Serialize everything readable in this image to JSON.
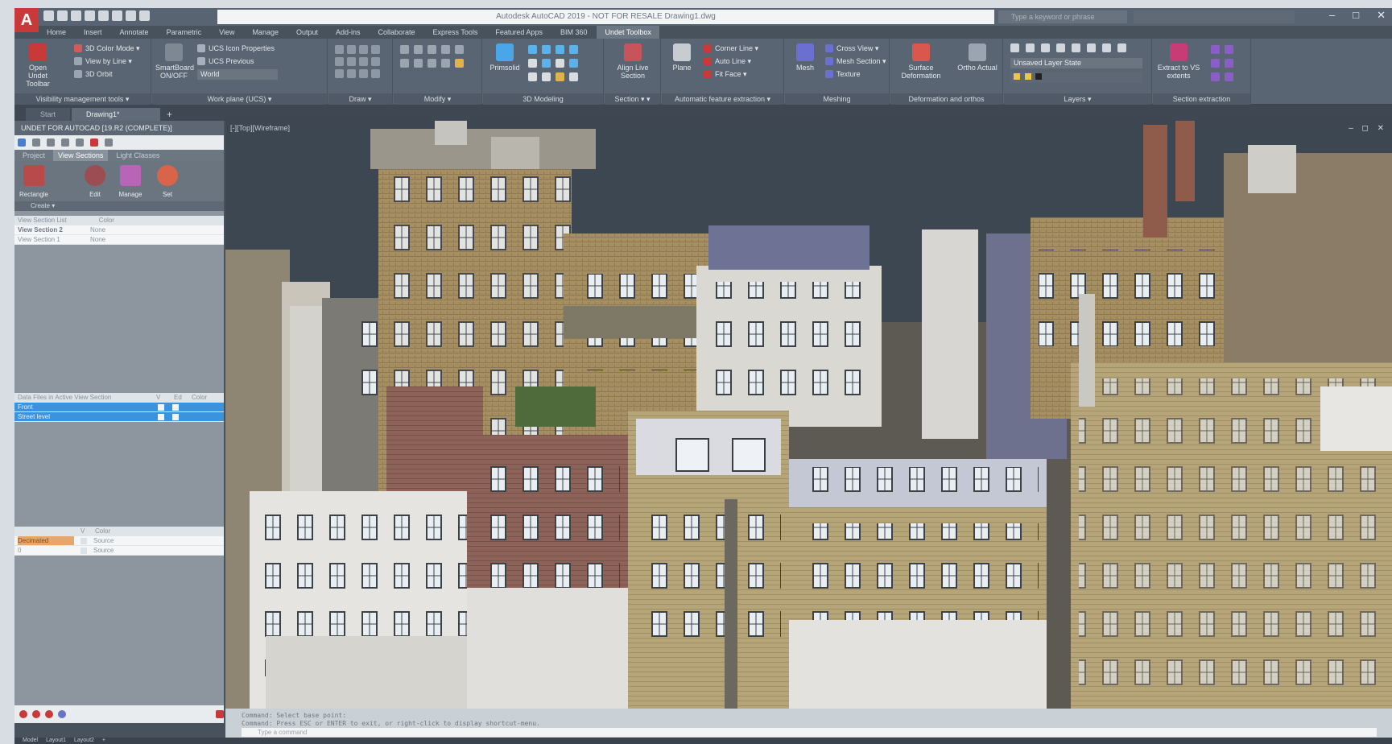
{
  "window": {
    "title": "Autodesk AutoCAD 2019 - NOT FOR RESALE   Drawing1.dwg",
    "logo": "A",
    "search_placeholder": "Type a keyword or phrase",
    "user": "",
    "controls": [
      "–",
      "□",
      "✕"
    ]
  },
  "ribbon_tabs": [
    "Home",
    "Insert",
    "Annotate",
    "Parametric",
    "View",
    "Manage",
    "Output",
    "Add-ins",
    "Collaborate",
    "Express Tools",
    "Featured Apps",
    "BIM 360",
    "Undet Toolbox"
  ],
  "ribbon_active_tab": 12,
  "ribbon": {
    "panels": [
      {
        "footer": "Visibility management tools ▾"
      },
      {
        "footer": "Work plane (UCS) ▾"
      },
      {
        "footer": "Draw ▾"
      },
      {
        "footer": "Modify ▾"
      },
      {
        "footer": "3D Modeling"
      },
      {
        "footer": "Section ▾  ▾"
      },
      {
        "footer": "Automatic feature extraction ▾"
      },
      {
        "footer": "Meshing"
      },
      {
        "footer": "Deformation and orthos"
      },
      {
        "footer": "Layers ▾"
      },
      {
        "footer": "Section extraction"
      }
    ],
    "open_undet_toolbar": "Open Undet Toolbar",
    "three_d_color_mode": "3D Color Mode ▾",
    "view_by_line": "View by Line ▾",
    "three_d_orbit": "3D Orbit",
    "smartboard": "SmartBoard ON/OFF",
    "ucs_icon_properties": "UCS Icon Properties",
    "ucs_previous": "UCS Previous",
    "world": "World",
    "primsolid": "Primsolid",
    "align_live_section": "Align Live Section",
    "plane": "Plane",
    "corner_line": "Corner Line ▾",
    "auto_line": "Auto Line ▾",
    "fit_face": "Fit Face ▾",
    "mesh": "Mesh",
    "cross_view": "Cross View ▾",
    "mesh_section": "Mesh Section ▾",
    "texture": "Texture",
    "surface_deformation": "Surface Deformation",
    "ortho_actual": "Ortho Actual",
    "unsaved_layer_state": "Unsaved Layer State",
    "extract_to_vs": "Extract to VS extents"
  },
  "file_tabs": [
    "Start",
    "Drawing1*"
  ],
  "file_tab_add": "+",
  "palette": {
    "title": "UNDET FOR AUTOCAD [19.R2 (COMPLETE)]",
    "tabs": [
      "Project",
      "View Sections",
      "Light Classes"
    ],
    "active_tab": 1,
    "tools": [
      "Rectangle",
      "Edit",
      "Manage",
      "Set"
    ],
    "tools_footer": "Create ▾",
    "view_section_list": {
      "header": [
        "View Section List",
        "Color"
      ],
      "rows": [
        {
          "name": "View Section 2",
          "color": "None"
        },
        {
          "name": "View Section 1",
          "color": "None"
        }
      ]
    },
    "data_files": {
      "header": [
        "Data Files in Active View Section",
        "V",
        "Ed",
        "Color"
      ],
      "rows": [
        {
          "name": "Front"
        },
        {
          "name": "Street level"
        }
      ]
    },
    "layers": {
      "header": [
        "",
        "V",
        "Color"
      ],
      "rows": [
        {
          "name": "Decimated",
          "color": "Source"
        },
        {
          "name": "0",
          "color": "Source"
        }
      ]
    }
  },
  "viewport": {
    "label": "[-][Top][Wireframe]",
    "controls": "– ◻ ✕"
  },
  "command_line": {
    "history": [
      "Command:  Select base point:",
      "Command:  Press ESC or ENTER to exit, or right-click to display shortcut-menu."
    ],
    "placeholder": "Type a command"
  },
  "layout_tabs": [
    "Model",
    "Layout1",
    "Layout2",
    "+"
  ],
  "colors": {
    "accent_red": "#c8393a",
    "selection_blue": "#3c93dd",
    "chrome": "#596572"
  }
}
